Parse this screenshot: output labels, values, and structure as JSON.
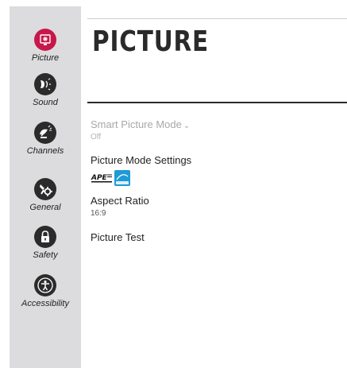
{
  "sidebar": {
    "items": [
      {
        "label": "Picture",
        "icon": "picture-icon",
        "active": true
      },
      {
        "label": "Sound",
        "icon": "sound-icon"
      },
      {
        "label": "Channels",
        "icon": "channels-icon"
      },
      {
        "label": "General",
        "icon": "general-icon"
      },
      {
        "label": "Safety",
        "icon": "lock-icon"
      },
      {
        "label": "Accessibility",
        "icon": "accessibility-icon"
      }
    ]
  },
  "main": {
    "title": "PICTURE",
    "items": [
      {
        "label": "Smart Picture Mode",
        "value": "Off",
        "disabled": true
      },
      {
        "label": "Picture Mode Settings",
        "badges": [
          "ape-badge",
          "energy-star-badge"
        ]
      },
      {
        "label": "Aspect Ratio",
        "value": "16:9"
      },
      {
        "label": "Picture Test"
      }
    ]
  },
  "colors": {
    "accent": "#c8174a",
    "sidebar_bg": "#dcdcde",
    "icon_bg": "#2b2b2b",
    "energy_star": "#1e9ad6"
  }
}
